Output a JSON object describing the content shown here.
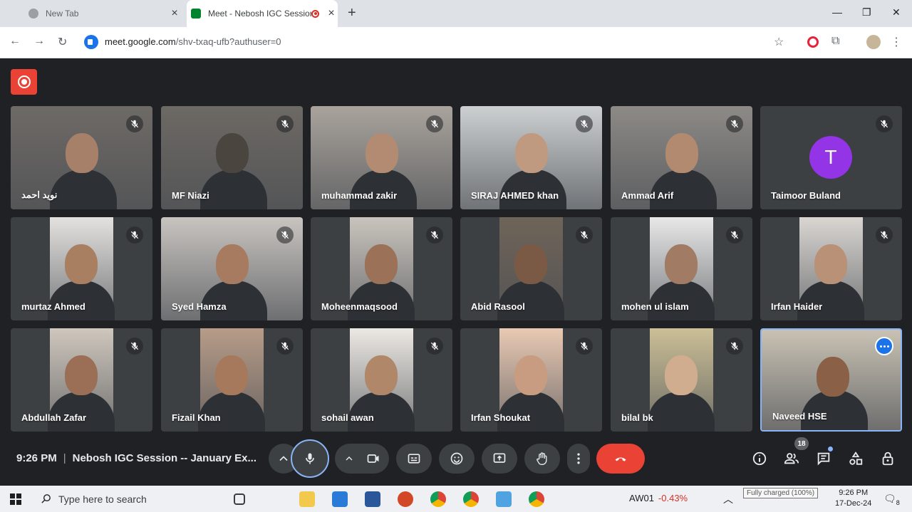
{
  "browser": {
    "tabs": [
      {
        "title": "New Tab",
        "active": false
      },
      {
        "title": "Meet - Nebosh IGC Session",
        "active": true,
        "recording": true
      }
    ],
    "url_host": "meet.google.com",
    "url_path": "/shv-txaq-ufb?authuser=0"
  },
  "meeting": {
    "time": "9:26 PM",
    "separator": "|",
    "title": "Nebosh IGC Session -- January Ex...",
    "participant_count": "18",
    "participants": [
      {
        "name": "نوید احمد",
        "muted": true,
        "tone": "#6e6a66",
        "frame": "full",
        "skin": "#a7806a"
      },
      {
        "name": "MF Niazi",
        "muted": true,
        "tone": "#6d6964",
        "frame": "full",
        "skin": "#4b4540"
      },
      {
        "name": "muhammad zakir",
        "muted": true,
        "tone": "#a9a39c",
        "frame": "full",
        "skin": "#b28b72"
      },
      {
        "name": "SIRAJ AHMED khan",
        "muted": true,
        "tone": "#cdd0d1",
        "frame": "full",
        "skin": "#c09a80"
      },
      {
        "name": "Ammad Arif",
        "muted": true,
        "tone": "#8d8a86",
        "frame": "full",
        "skin": "#b18a6f"
      },
      {
        "name": "Taimoor Buland",
        "muted": true,
        "tone": "#3c4043",
        "frame": "avatar",
        "initial": "T"
      },
      {
        "name": "murtaz Ahmed",
        "muted": true,
        "tone": "#e4e2e0",
        "frame": "narrow",
        "skin": "#a97f62"
      },
      {
        "name": "Syed Hamza",
        "muted": true,
        "tone": "#c8c4c0",
        "frame": "full",
        "skin": "#a77b5f"
      },
      {
        "name": "Moheenmaqsood",
        "muted": true,
        "tone": "#c9c4bd",
        "frame": "narrow",
        "skin": "#9b7258"
      },
      {
        "name": "Abid Rasool",
        "muted": true,
        "tone": "#6f6459",
        "frame": "narrow",
        "skin": "#7a5a45"
      },
      {
        "name": "mohen ul islam",
        "muted": true,
        "tone": "#e8e8e8",
        "frame": "narrow",
        "skin": "#a17b63"
      },
      {
        "name": "Irfan Haider",
        "muted": true,
        "tone": "#d9d6d2",
        "frame": "narrow",
        "skin": "#b99177"
      },
      {
        "name": "Abdullah Zafar",
        "muted": true,
        "tone": "#cfc7bd",
        "frame": "narrow",
        "skin": "#9a6f55"
      },
      {
        "name": "Fizail Khan",
        "muted": true,
        "tone": "#b79c88",
        "frame": "narrow",
        "skin": "#a7795c"
      },
      {
        "name": "sohail awan",
        "muted": true,
        "tone": "#ece9e4",
        "frame": "narrow",
        "skin": "#b08769"
      },
      {
        "name": "Irfan Shoukat",
        "muted": true,
        "tone": "#e9c9b3",
        "frame": "narrow",
        "skin": "#c79c80"
      },
      {
        "name": "bilal bk",
        "muted": true,
        "tone": "#cbbf97",
        "frame": "narrow",
        "skin": "#d1ad90"
      },
      {
        "name": "Naveed HSE",
        "muted": false,
        "tone": "#c9c2b4",
        "frame": "full",
        "skin": "#8a6147",
        "active": true
      }
    ]
  },
  "taskbar": {
    "search_placeholder": "Type here to search",
    "stock_symbol": "AW01",
    "stock_change": "-0.43%",
    "battery_tooltip": "Fully charged (100%)",
    "clock_time": "9:26 PM",
    "clock_date": "17-Dec-24",
    "notification_count": "8"
  },
  "colors": {
    "meet_bg": "#202124",
    "tile_bg": "#3c4043",
    "end_call": "#ea4335",
    "accent": "#8ab4f8"
  }
}
